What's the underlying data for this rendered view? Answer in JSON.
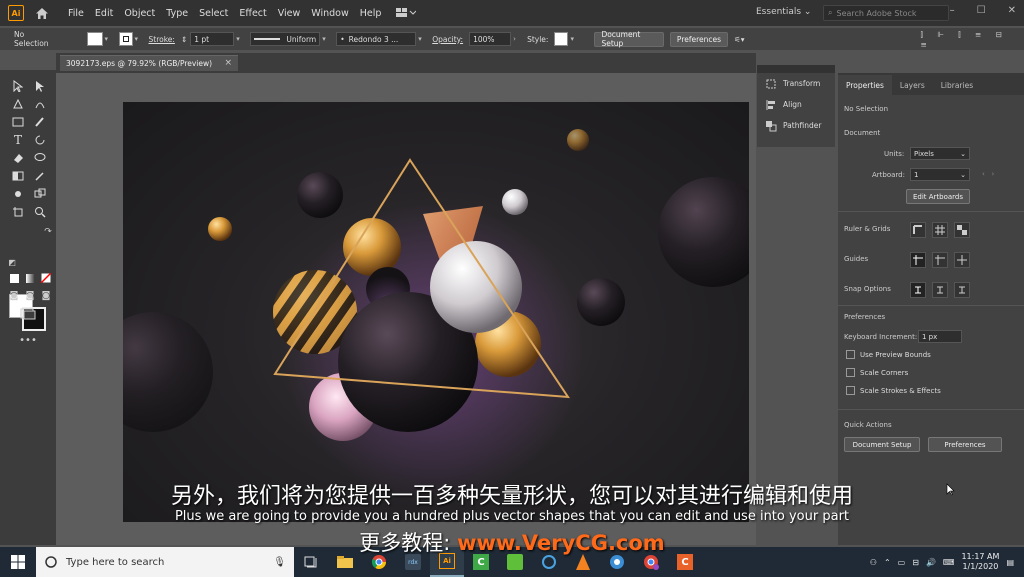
{
  "app": {
    "logo": "Ai",
    "menu": [
      "File",
      "Edit",
      "Object",
      "Type",
      "Select",
      "Effect",
      "View",
      "Window",
      "Help"
    ],
    "workspace": "Essentials",
    "search_placeholder": "Search Adobe Stock"
  },
  "control_bar": {
    "selection": "No Selection",
    "stroke_label": "Stroke:",
    "stroke_value": "1 pt",
    "profile": "Uniform",
    "brush": "Redondo 3 ...",
    "opacity_label": "Opacity:",
    "opacity_value": "100%",
    "style_label": "Style:",
    "document_setup": "Document Setup",
    "preferences": "Preferences"
  },
  "document_tab": {
    "title": "3092173.eps @ 79.92% (RGB/Preview)",
    "close": "×"
  },
  "mid_panel": {
    "items": [
      "Transform",
      "Align",
      "Pathfinder"
    ]
  },
  "properties_panel": {
    "tabs": [
      "Properties",
      "Layers",
      "Libraries"
    ],
    "selection": "No Selection",
    "document_heading": "Document",
    "units_label": "Units:",
    "units_value": "Pixels",
    "artboard_label": "Artboard:",
    "artboard_value": "1",
    "edit_artboards": "Edit Artboards",
    "ruler_grids": "Ruler & Grids",
    "guides": "Guides",
    "snap_options": "Snap Options",
    "preferences_heading": "Preferences",
    "keyboard_increment_label": "Keyboard Increment:",
    "keyboard_increment_value": "1 px",
    "checks": [
      "Use Preview Bounds",
      "Scale Corners",
      "Scale Strokes & Effects"
    ],
    "quick_actions": "Quick Actions",
    "qa_document_setup": "Document Setup",
    "qa_preferences": "Preferences"
  },
  "subtitles": {
    "chinese": "另外，我们将为您提供一百多种矢量形状，您可以对其进行编辑和使用",
    "english": "Plus we are going to provide you a hundred plus vector shapes that you can edit and use into your part",
    "promo_prefix": "更多教程: ",
    "promo_url": "www.VeryCG.com"
  },
  "taskbar": {
    "search_placeholder": "Type here to search",
    "time": "11:17 AM",
    "date": "1/1/2020"
  },
  "colors": {
    "accent_orange": "#ff9a00",
    "promo_orange": "#ff6a1a"
  }
}
